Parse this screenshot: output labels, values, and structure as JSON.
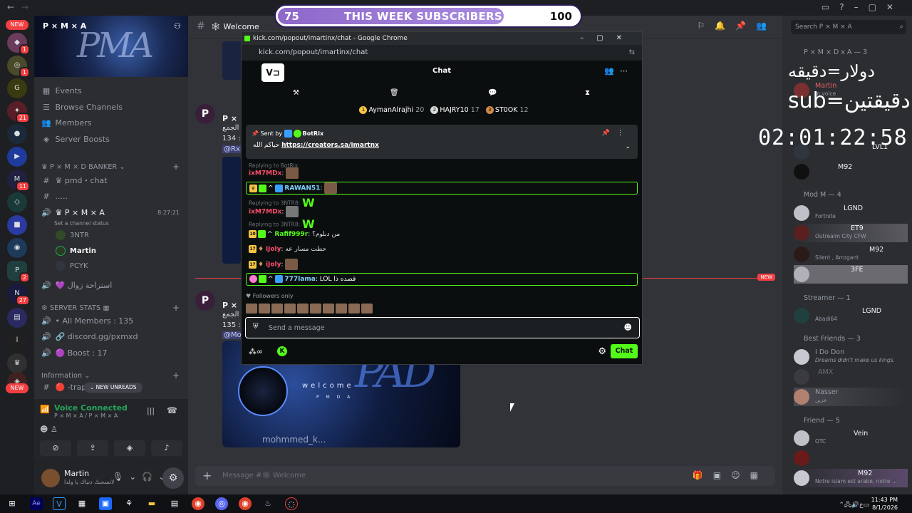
{
  "overlay": {
    "sub_left": "75",
    "sub_title": "THIS WEEK SUBSCRIBERS",
    "sub_right": "100",
    "sub_progress": 0.75,
    "arabic_line1": "دولار=دقيقه",
    "arabic_line2": "sub=دقيقتين",
    "timer": "02:01:22:58"
  },
  "server": {
    "name": "P × M × A",
    "channels": [
      {
        "label": "Events",
        "icon": "calendar-icon"
      },
      {
        "label": "Browse Channels",
        "icon": "list-icon"
      },
      {
        "label": "Members",
        "icon": "members-icon"
      },
      {
        "label": "Server Boosts",
        "icon": "boost-icon"
      }
    ],
    "cat_banker": "P × M × D Banker",
    "chan_pmd": "pmd・chat",
    "chan_dots": ".....",
    "voice_channel": "P × M × A",
    "voice_time": "8:27:21",
    "voice_status": "Set a channel status",
    "voice_users": [
      "3NTR",
      "Martin",
      "PCYK"
    ],
    "chan_rest": "استراحة زوال",
    "cat_stats": "SERVER STATS",
    "stats": [
      "All Members : 135",
      "discord.gg/pxmxd",
      "Boost : 17"
    ],
    "cat_info": "Information",
    "chan_trap": "-trap",
    "new_unreads": "NEW UNREADS",
    "voice_connected": "Voice Connected",
    "voice_sub": "P × M × A / P × M × A",
    "user_name": "Martin",
    "user_status": "لاتسحبك دنياك يا ولدا"
  },
  "rail": {
    "new_label": "NEW",
    "badges": [
      "1",
      "1",
      "21",
      "11",
      "2",
      "27"
    ]
  },
  "main": {
    "channel_name": "Welcome",
    "msg1_name": "P × M",
    "msg1_line1": "الجمع",
    "msg1_line2": "134 :",
    "msg1_mention": "@Rx",
    "msg2_name": "P × M",
    "msg2_line1": "الجمع",
    "msg2_line2": "135 :",
    "msg2_mention": "@Mo",
    "card_welcome": "welcome",
    "card_pmda": "P M D A",
    "card_user": "mohmmed_k...",
    "new_pill": "NEW",
    "input_placeholder": "Message #🕸 Welcome"
  },
  "kick": {
    "window_title": "kick.com/popout/imartinx/chat - Google Chrome",
    "url": "kick.com/popout/imartinx/chat",
    "chat_title": "Chat",
    "gifters": [
      {
        "rank": "1",
        "name": "AymanAlrajhi",
        "count": "20",
        "color": "#f5c542"
      },
      {
        "rank": "2",
        "name": "HAJRY10",
        "count": "17",
        "color": "#d9d9d9"
      },
      {
        "rank": "3",
        "name": "ST0OK",
        "count": "12",
        "color": "#d08a4a"
      }
    ],
    "pinned_by": "Sent by",
    "pinned_bot": "BotRix",
    "pinned_prefix": "حياكم الله",
    "pinned_link": "https://creators.sa/imartnx",
    "messages": [
      {
        "reply": "Replying to BotRix:",
        "user": "ixM7MDx",
        "color": "#ff4d6d",
        "text": ":"
      },
      {
        "user": "RAWAN51",
        "color": "#7fd4ff",
        "text": ":"
      },
      {
        "reply": "Replying to 3NTR8:",
        "user": "ixM7MDx",
        "color": "#ff4d6d",
        "text": ":"
      },
      {
        "reply": "Replying to 3NTR8:",
        "user": "Rafif999r",
        "color": "#53fc18",
        "text": ": من دبلوم؟"
      },
      {
        "user": "iJoly",
        "color": "#ff4d6d",
        "text": ": حطت مسار عه"
      },
      {
        "user": "iJoly",
        "color": "#ff4d6d",
        "text": ":"
      },
      {
        "user": "777lama",
        "color": "#7fd4ff",
        "text": ": LOL قصده ذا"
      }
    ],
    "followers_only": "Followers only",
    "input_placeholder": "Send a message",
    "send_button": "Chat"
  },
  "members": {
    "search_placeholder": "Search P × M × A",
    "groups": [
      {
        "label": "P × M × D x A — 3"
      },
      {
        "label": "Mod M — 4"
      },
      {
        "label": "Streamer — 1"
      },
      {
        "label": "Best Friends — 3"
      },
      {
        "label": "Friend — 5"
      }
    ],
    "list": [
      {
        "name": "Martin",
        "status": "In voice"
      },
      {
        "name": "",
        "status": "LVL1"
      },
      {
        "name": "M92",
        "status": ""
      },
      {
        "name": "LGND",
        "status": "Fortnite"
      },
      {
        "name": "ET9",
        "status": "Outrealm City CFW"
      },
      {
        "name": "M92",
        "status": "Silent , Arrogant"
      },
      {
        "name": "3FE",
        "status": ""
      },
      {
        "name": "LGND",
        "status": "Abadi64"
      },
      {
        "name": "I Do Don",
        "status": "Dreams didn't make us kings."
      },
      {
        "name": "AMX",
        "status": ""
      },
      {
        "name": "Nasser",
        "status": "خزين"
      },
      {
        "name": "Vein",
        "status": "OTC"
      },
      {
        "name": "",
        "status": ""
      },
      {
        "name": "M92",
        "status": "Notre islam est arabe, notre ..."
      }
    ]
  },
  "taskbar": {
    "time": "11:43 PM",
    "date": "8/1/2026"
  }
}
